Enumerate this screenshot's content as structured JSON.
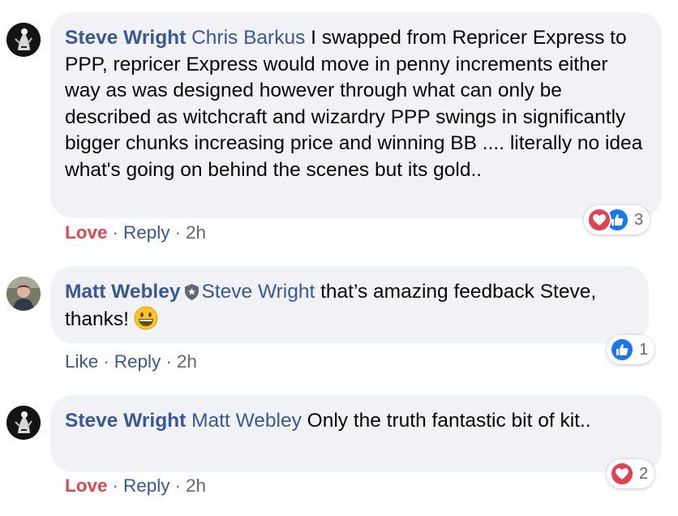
{
  "comments": [
    {
      "author": "Steve Wright",
      "mention": "Chris Barkus",
      "text": " I swapped from Repricer Express to PPP, repricer Express would move in penny increments either way as was designed however through what can only be described as witchcraft and wizardry PPP swings in significantly bigger chunks increasing price and winning BB .... literally no idea what's going on behind the scenes but its gold..",
      "action": "Love",
      "reply": "Reply",
      "time": "2h",
      "reaction_icons": [
        "love-icon",
        "like-icon"
      ],
      "reaction_count": "3"
    },
    {
      "author": "Matt Webley",
      "mention": "Steve Wright",
      "text": " that’s amazing feedback Steve, thanks!",
      "action": "Like",
      "reply": "Reply",
      "time": "2h",
      "reaction_icons": [
        "like-icon"
      ],
      "reaction_count": "1"
    },
    {
      "author": "Steve Wright",
      "mention": "Matt Webley",
      "text": " Only the truth fantastic bit of kit..",
      "action": "Love",
      "reply": "Reply",
      "time": "2h",
      "reaction_icons": [
        "love-icon"
      ],
      "reaction_count": "2"
    }
  ],
  "separator": "·",
  "colors": {
    "name_link": "#385898",
    "love": "#e0464f",
    "like": "#1877f2",
    "bubble": "#f0f2f5",
    "meta": "#65676b"
  }
}
